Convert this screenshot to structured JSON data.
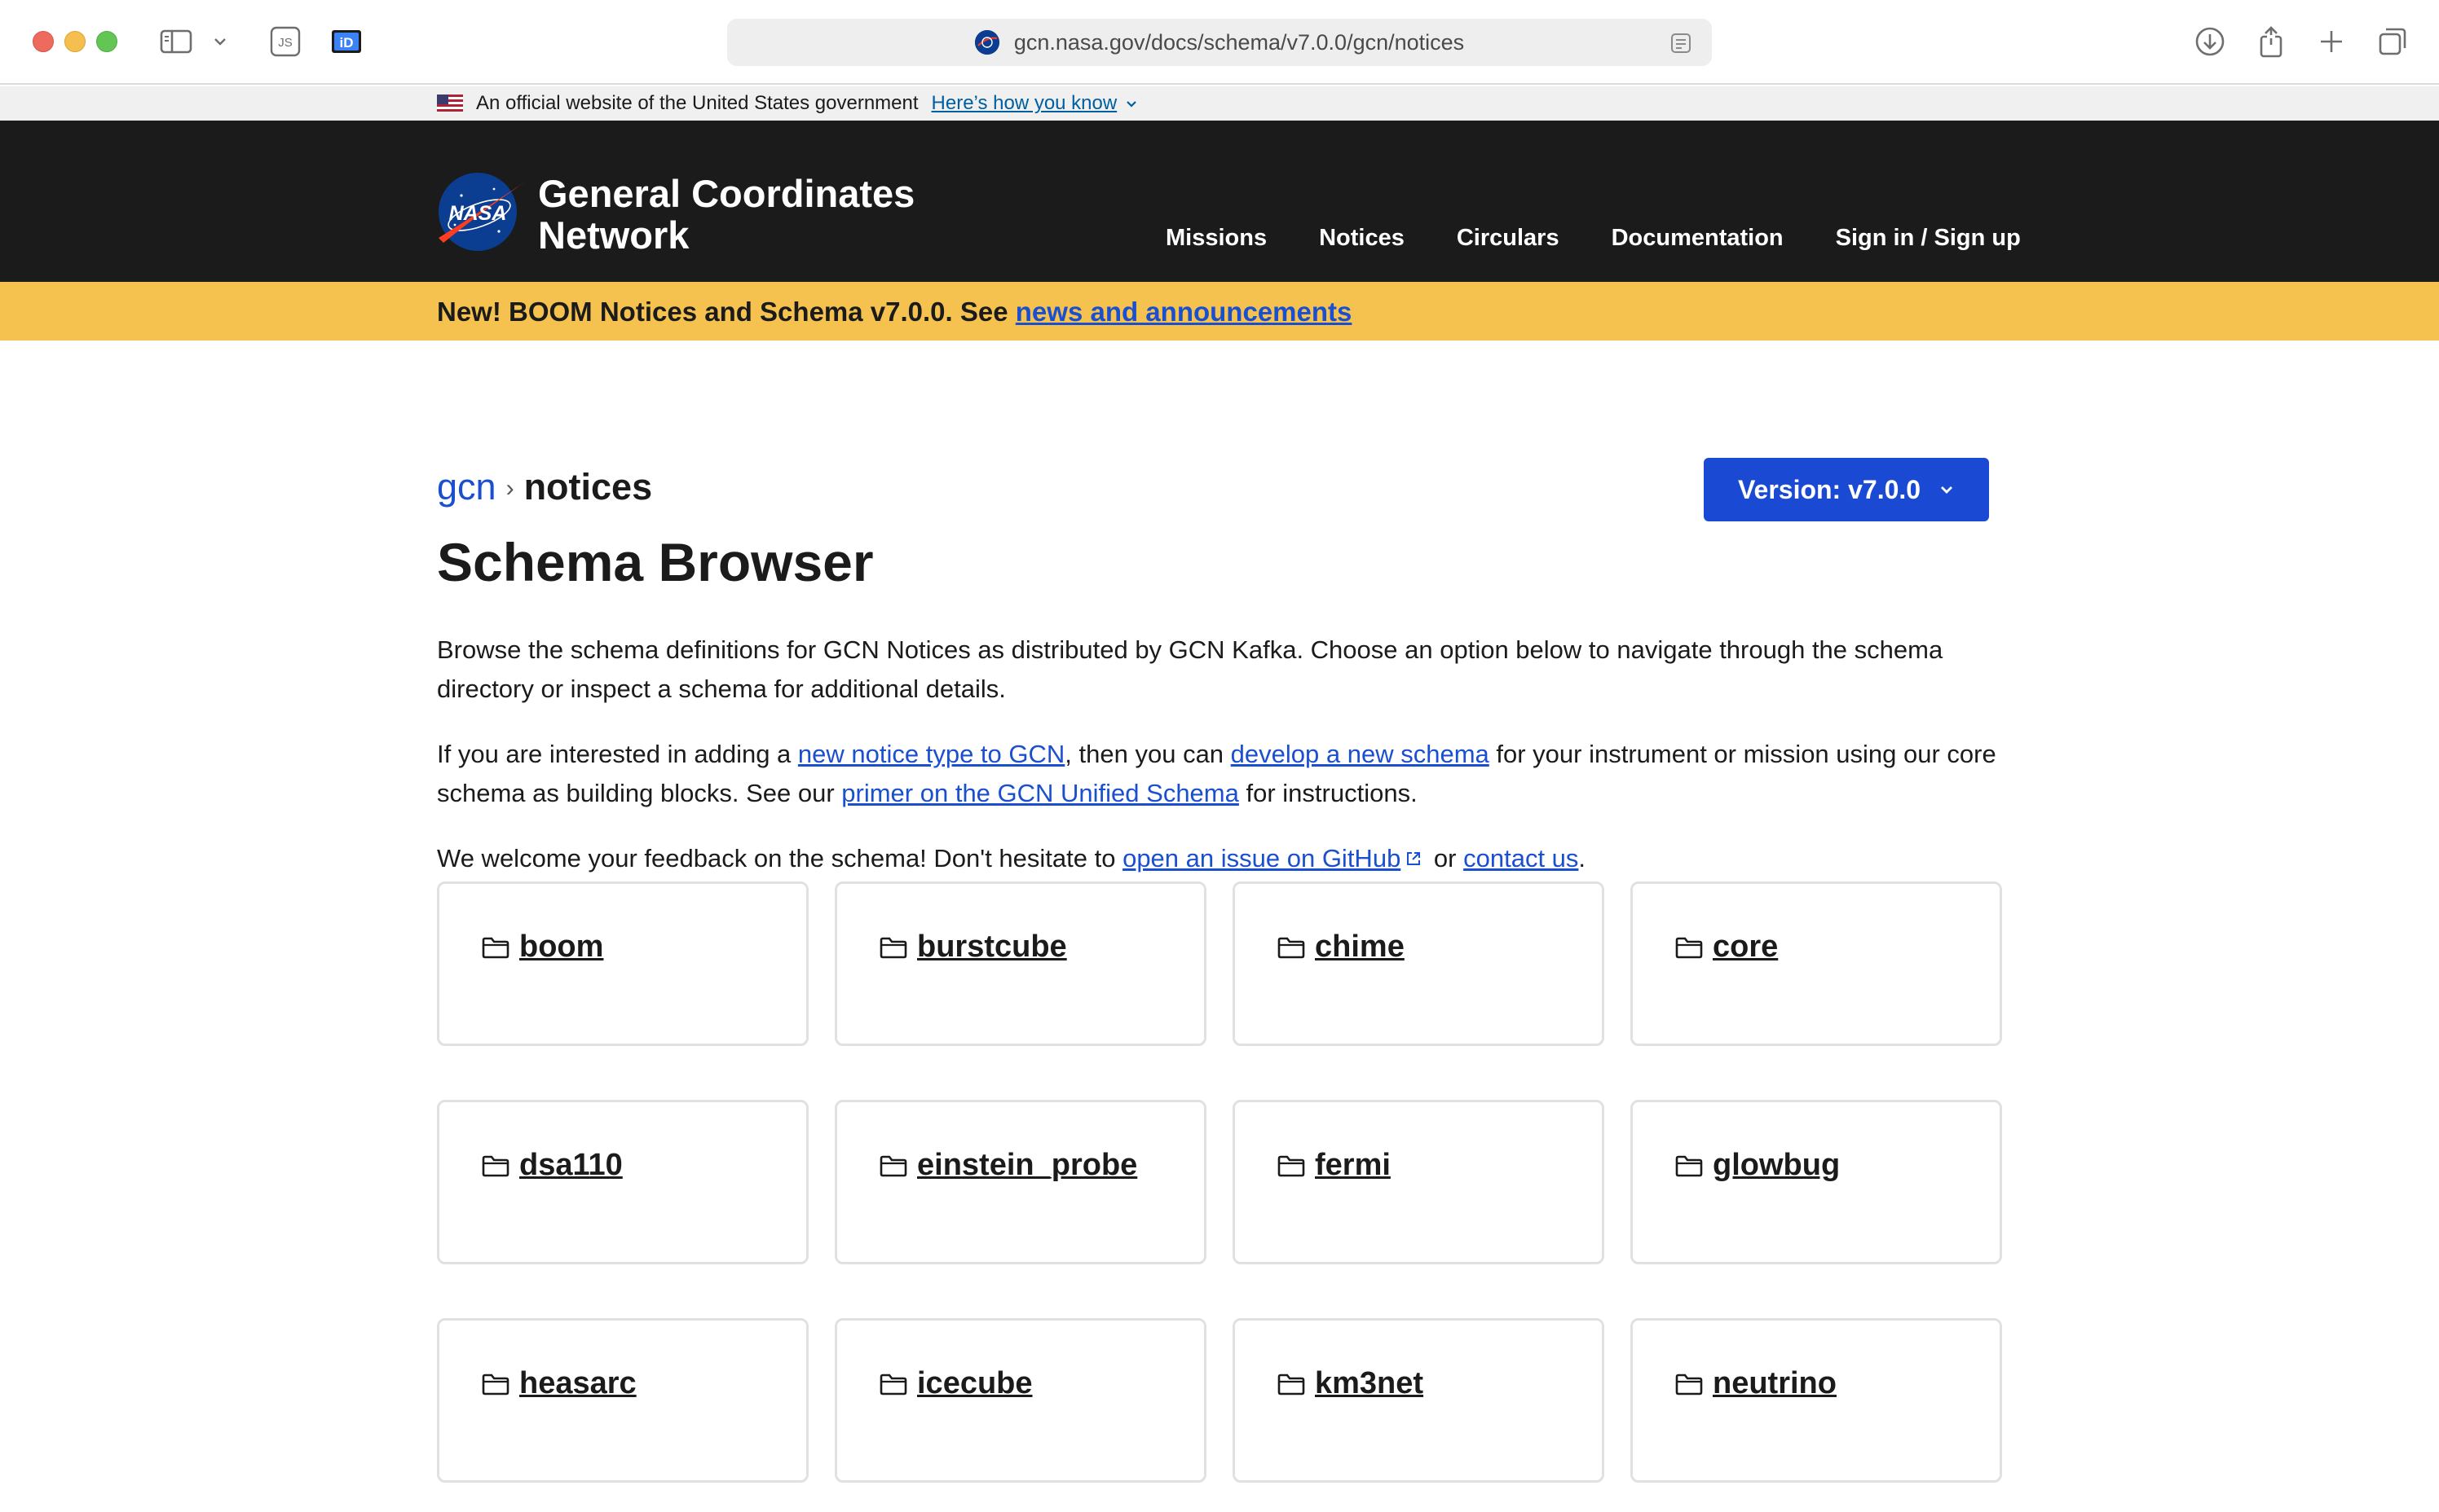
{
  "browser": {
    "url": "gcn.nasa.gov/docs/schema/v7.0.0/gcn/notices",
    "js_label": "JS",
    "id_label": "iD"
  },
  "gov_banner": {
    "text": "An official website of the United States government",
    "link": "Here’s how you know"
  },
  "header": {
    "logo_text": "NASA",
    "title_line1": "General Coordinates",
    "title_line2": "Network",
    "nav": [
      "Missions",
      "Notices",
      "Circulars",
      "Documentation",
      "Sign in / Sign up"
    ]
  },
  "announcement": {
    "text": "New! BOOM Notices and Schema v7.0.0. See ",
    "link": "news and announcements"
  },
  "breadcrumb": {
    "parent": "gcn",
    "separator": "›",
    "current": "notices"
  },
  "version_button": "Version: v7.0.0",
  "page_title": "Schema Browser",
  "intro": {
    "p1": "Browse the schema definitions for GCN Notices as distributed by GCN Kafka. Choose an option below to navigate through the schema directory or inspect a schema for additional details.",
    "p2_a": "If you are interested in adding a ",
    "p2_link1": "new notice type to GCN",
    "p2_b": ", then you can ",
    "p2_link2": "develop a new schema",
    "p2_c": " for your instrument or mission using our core schema as building blocks. See our ",
    "p2_link3": "primer on the GCN Unified Schema",
    "p2_d": " for instructions.",
    "p3_a": "We welcome your feedback on the schema! Don't hesitate to ",
    "p3_link1": "open an issue on GitHub",
    "p3_b": " or ",
    "p3_link2": "contact us",
    "p3_c": "."
  },
  "folders": [
    "boom",
    "burstcube",
    "chime",
    "core",
    "dsa110",
    "einstein_probe",
    "fermi",
    "glowbug",
    "heasarc",
    "icecube",
    "km3net",
    "neutrino"
  ],
  "colors": {
    "header_bg": "#1b1b1b",
    "announce_bg": "#f5c24f",
    "link": "#1a4fd0",
    "button": "#1a4ad4"
  }
}
